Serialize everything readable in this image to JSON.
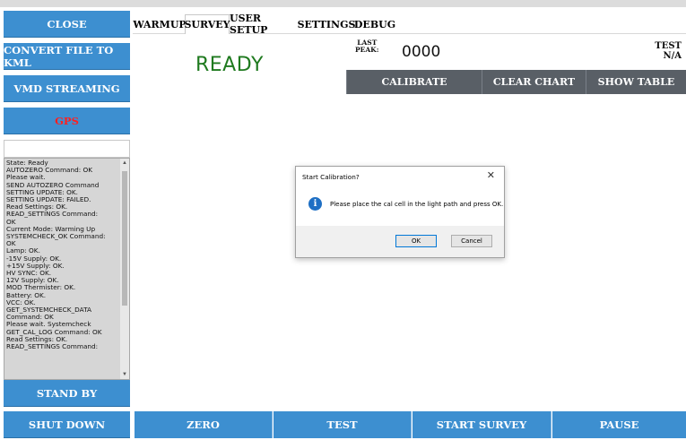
{
  "sidebar": {
    "close_label": "CLOSE",
    "convert_label": "CONVERT FILE TO KML",
    "vmd_label": "VMD STREAMING",
    "gps_label": "GPS",
    "standby_label": "STAND BY",
    "shutdown_label": "SHUT DOWN",
    "gps_color": "#ff2020",
    "button_color": "#3d8fd0"
  },
  "log": {
    "text": "State: Ready\nAUTOZERO Command: OK\nPlease wait.\nSEND AUTOZERO Command\nSETTING UPDATE: OK.\nSETTING UPDATE: FAILED.\nRead Settings: OK.\nREAD_SETTINGS Command:\nOK\nCurrent Mode: Warming Up\nSYSTEMCHECK_OK Command:\nOK\nLamp: OK.\n-15V Supply: OK.\n+15V Supply: OK.\nHV SYNC: OK.\n12V Supply: OK.\nMOD Thermister: OK.\nBattery: OK.\nVCC: OK.\nGET_SYSTEMCHECK_DATA\nCommand: OK\nPlease wait. Systemcheck\nGET_CAL_LOG Command: OK\nRead Settings: OK.\nREAD_SETTINGS Command:"
  },
  "tabs": [
    {
      "label": "WARMUP"
    },
    {
      "label": "SURVEY"
    },
    {
      "label": "USER SETUP"
    },
    {
      "label": "SETTINGS"
    },
    {
      "label": "DEBUG"
    }
  ],
  "main": {
    "status": "READY",
    "status_color": "#1f7a1f",
    "last_peak_label_1": "LAST",
    "last_peak_label_2": "PEAK:",
    "last_peak_value": "0000",
    "test_label": "TEST",
    "test_value": "N/A",
    "calibrate_label": "CALIBRATE",
    "clear_chart_label": "CLEAR CHART",
    "show_table_label": "SHOW TABLE"
  },
  "dialog": {
    "title": "Start Calibration?",
    "close_glyph": "✕",
    "icon_glyph": "i",
    "message": "Please place the cal cell in the light path and press OK.",
    "ok_label": "OK",
    "cancel_label": "Cancel"
  },
  "bottom": {
    "zero_label": "ZERO",
    "test_label": "TEST",
    "start_survey_label": "START SURVEY",
    "pause_label": "PAUSE"
  }
}
